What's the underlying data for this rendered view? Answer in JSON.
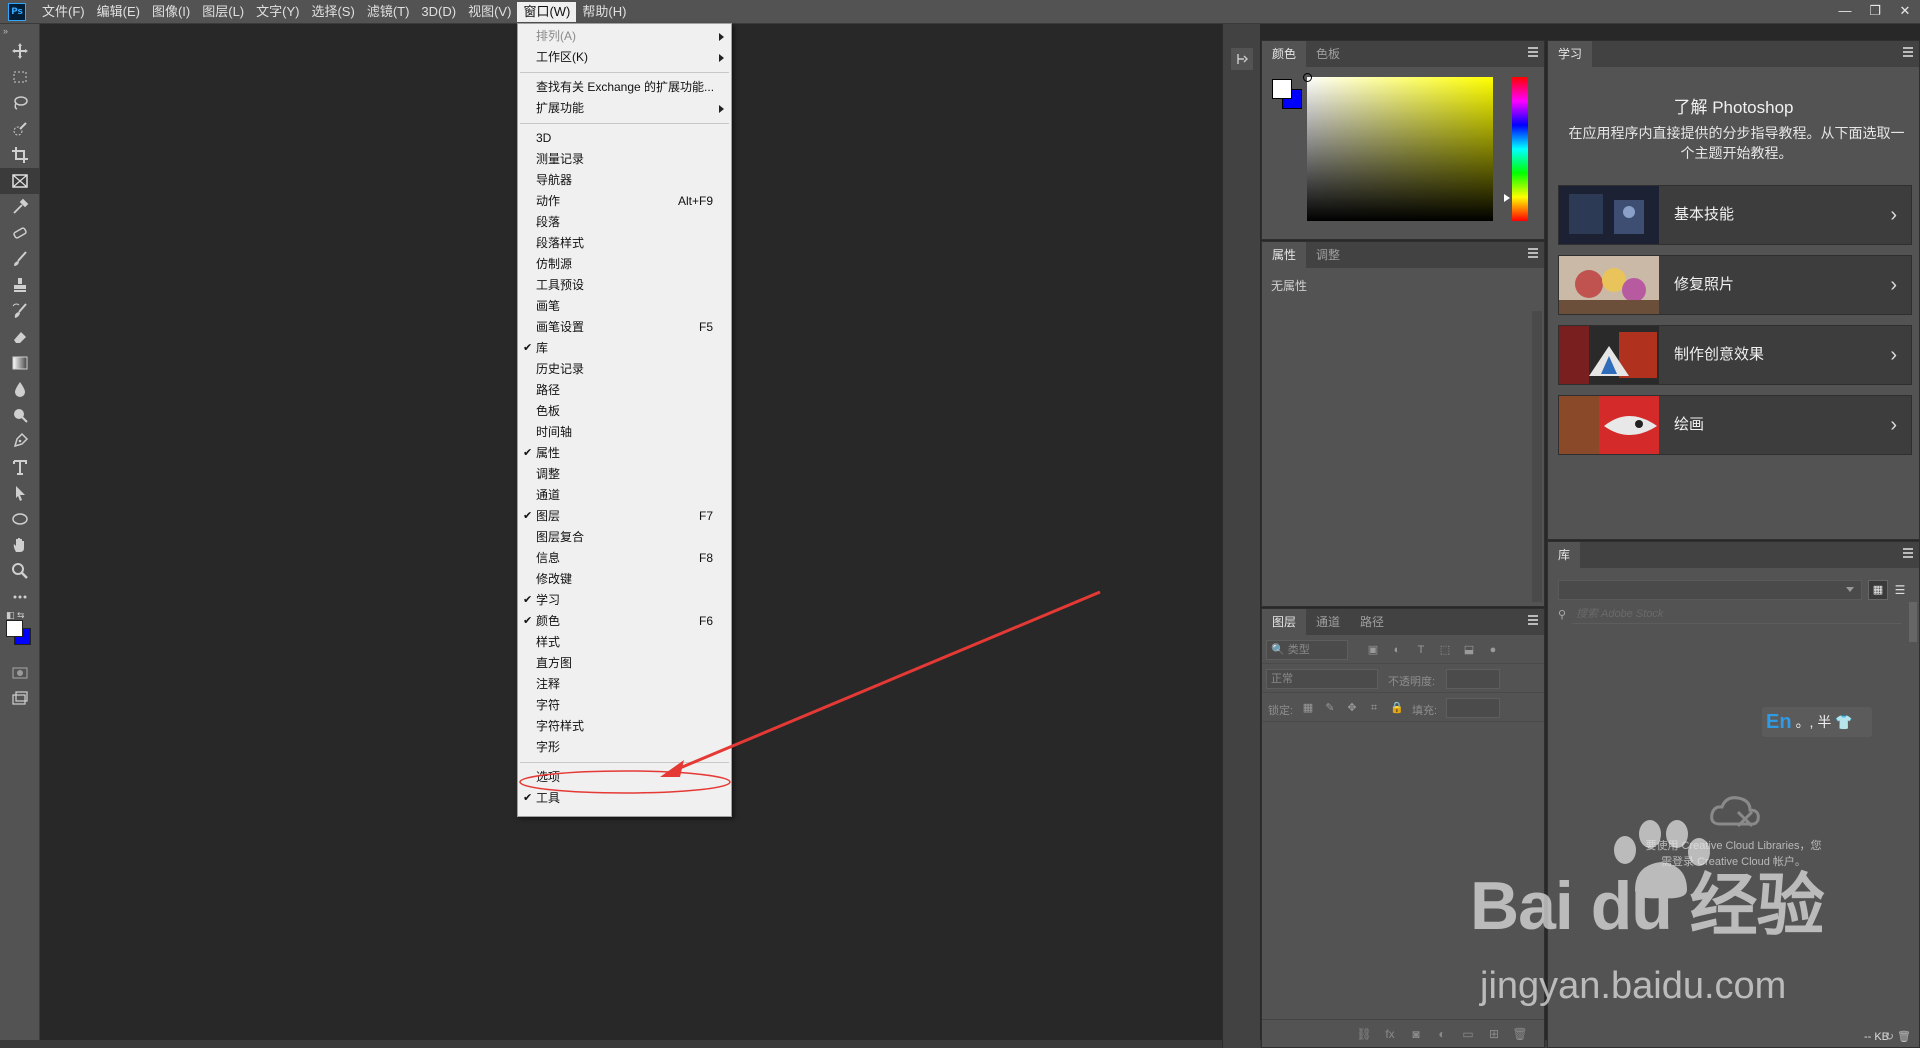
{
  "menubar": {
    "logo": "Ps",
    "items": [
      "文件(F)",
      "编辑(E)",
      "图像(I)",
      "图层(L)",
      "文字(Y)",
      "选择(S)",
      "滤镜(T)",
      "3D(D)",
      "视图(V)",
      "窗口(W)",
      "帮助(H)"
    ],
    "active_index": 9,
    "window_controls": [
      "—",
      "❐",
      "✕"
    ]
  },
  "window_menu": {
    "items": [
      {
        "label": "排列(A)",
        "submenu": true,
        "disabled": true
      },
      {
        "label": "工作区(K)",
        "submenu": true
      },
      {
        "separator": true
      },
      {
        "label": "查找有关 Exchange 的扩展功能..."
      },
      {
        "label": "扩展功能",
        "submenu": true
      },
      {
        "separator": true
      },
      {
        "label": "3D"
      },
      {
        "label": "测量记录"
      },
      {
        "label": "导航器"
      },
      {
        "label": "动作",
        "shortcut": "Alt+F9"
      },
      {
        "label": "段落"
      },
      {
        "label": "段落样式"
      },
      {
        "label": "仿制源"
      },
      {
        "label": "工具预设"
      },
      {
        "label": "画笔"
      },
      {
        "label": "画笔设置",
        "shortcut": "F5"
      },
      {
        "label": "库",
        "checked": true
      },
      {
        "label": "历史记录"
      },
      {
        "label": "路径"
      },
      {
        "label": "色板"
      },
      {
        "label": "时间轴"
      },
      {
        "label": "属性",
        "checked": true
      },
      {
        "label": "调整"
      },
      {
        "label": "通道"
      },
      {
        "label": "图层",
        "checked": true,
        "shortcut": "F7"
      },
      {
        "label": "图层复合"
      },
      {
        "label": "信息",
        "shortcut": "F8"
      },
      {
        "label": "修改键"
      },
      {
        "label": "学习",
        "checked": true
      },
      {
        "label": "颜色",
        "checked": true,
        "shortcut": "F6"
      },
      {
        "label": "样式"
      },
      {
        "label": "直方图"
      },
      {
        "label": "注释"
      },
      {
        "label": "字符"
      },
      {
        "label": "字符样式"
      },
      {
        "label": "字形"
      },
      {
        "separator": true
      },
      {
        "label": "选项",
        "highlighted": true
      },
      {
        "label": "工具",
        "checked": true
      }
    ]
  },
  "color_panel": {
    "tabs": [
      "颜色",
      "色板"
    ],
    "foreground": "#ffffff",
    "background": "#0000ff",
    "hue": "#ffff00"
  },
  "properties_panel": {
    "tabs": [
      "属性",
      "调整"
    ],
    "empty_text": "无属性"
  },
  "layers_panel": {
    "tabs": [
      "图层",
      "通道",
      "路径"
    ],
    "filter_placeholder": "类型",
    "blend_mode": "正常",
    "opacity_label": "不透明度:",
    "lock_label": "锁定:",
    "fill_label": "填充:"
  },
  "learn_panel": {
    "tab": "学习",
    "title": "了解 Photoshop",
    "description": "在应用程序内直接提供的分步指导教程。从下面选取一个主题开始教程。",
    "cards": [
      {
        "title": "基本技能"
      },
      {
        "title": "修复照片"
      },
      {
        "title": "制作创意效果"
      },
      {
        "title": "绘画"
      }
    ]
  },
  "libraries_panel": {
    "tab": "库",
    "search_placeholder": "搜索 Adobe Stock",
    "message_line1": "要使用 Creative Cloud Libraries，您",
    "message_line2": "需登录 Creative Cloud 帐户。",
    "size": "-- KB"
  },
  "ime": {
    "mode": "En",
    "rest": "。, 半 👕"
  },
  "watermark": {
    "line1": "Bai du 经验",
    "line2": "jingyan.baidu.com"
  },
  "colors": {
    "annotation": "#e53935",
    "accent": "#31a8ff"
  }
}
